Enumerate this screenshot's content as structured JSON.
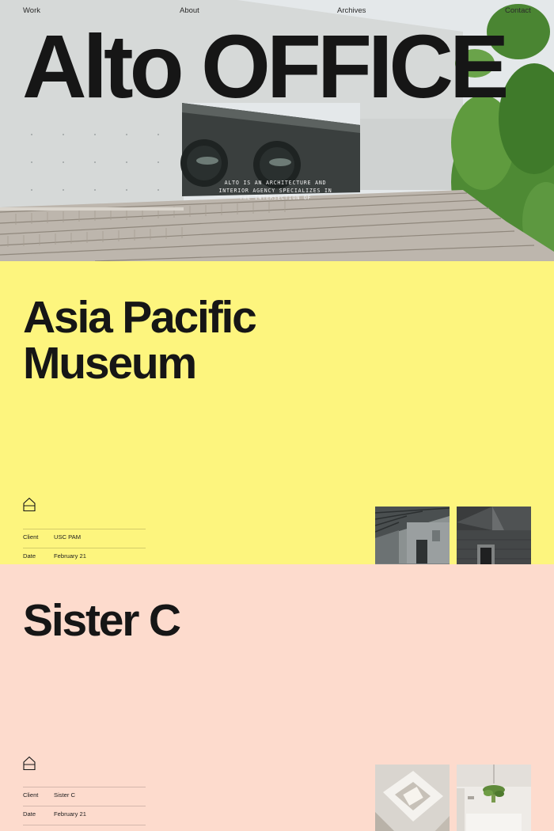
{
  "nav": {
    "work": "Work",
    "about": "About",
    "archives": "Archives",
    "contact": "Contact"
  },
  "hero": {
    "title": "Alto OFFICE",
    "tagline": "ALTO IS AN ARCHITECTURE AND INTERIOR AGENCY SPECIALIZES IN THE INTERSECTION OF"
  },
  "projects": [
    {
      "title": "Asia Pacific Museum",
      "icon": "house-outline-icon",
      "meta": [
        {
          "label": "Client",
          "value": "USC PAM"
        },
        {
          "label": "Date",
          "value": "February 21"
        }
      ],
      "background": "#fdf57e"
    },
    {
      "title": "Sister C",
      "icon": "house-outline-icon",
      "meta": [
        {
          "label": "Client",
          "value": "Sister C"
        },
        {
          "label": "Date",
          "value": "February 21"
        }
      ],
      "background": "#fddbcd"
    }
  ]
}
